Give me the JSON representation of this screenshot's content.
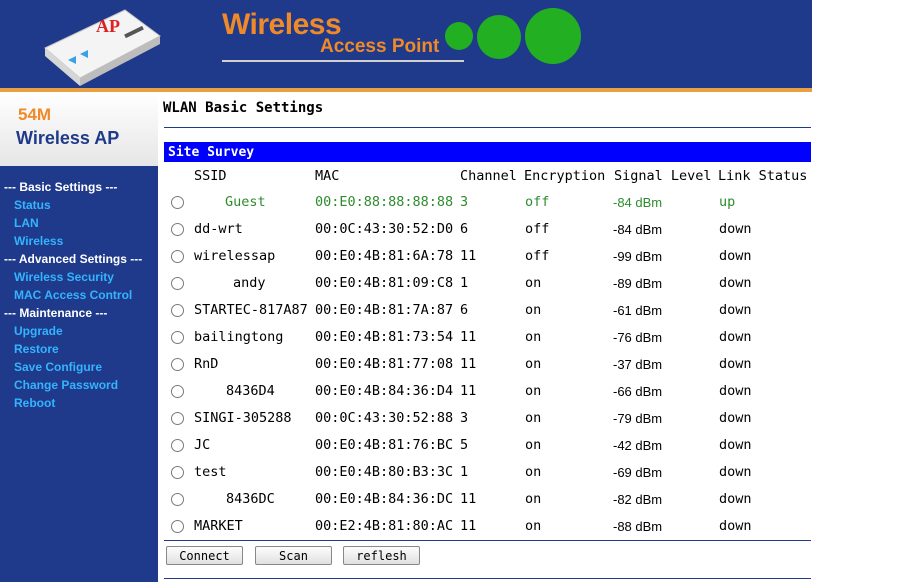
{
  "header": {
    "device_badge": "AP",
    "title_line1": "Wireless",
    "title_line2": "Access Point"
  },
  "logo": {
    "line1": "54M",
    "line2": "Wireless AP"
  },
  "sidebar": [
    {
      "label": "--- Basic Settings ---",
      "type": "heading"
    },
    {
      "label": "Status",
      "type": "link"
    },
    {
      "label": "LAN",
      "type": "link"
    },
    {
      "label": "Wireless",
      "type": "link"
    },
    {
      "label": "--- Advanced Settings ---",
      "type": "heading"
    },
    {
      "label": "Wireless Security",
      "type": "link"
    },
    {
      "label": "MAC Access Control",
      "type": "link"
    },
    {
      "label": "--- Maintenance ---",
      "type": "heading"
    },
    {
      "label": "Upgrade",
      "type": "link"
    },
    {
      "label": "Restore",
      "type": "link"
    },
    {
      "label": "Save Configure",
      "type": "link"
    },
    {
      "label": "Change Password",
      "type": "link"
    },
    {
      "label": "Reboot",
      "type": "link"
    }
  ],
  "page_title": "WLAN Basic Settings",
  "site_survey": {
    "label": "Site Survey",
    "columns": [
      "SSID",
      "MAC",
      "Channel",
      "Encryption",
      "Signal Level",
      "Link Status"
    ],
    "rows": [
      {
        "ssid": "Guest",
        "mac": "00:E0:88:88:88:88",
        "channel": "3",
        "encryption": "off",
        "signal": "-84 dBm",
        "link": "up"
      },
      {
        "ssid": "dd-wrt",
        "mac": "00:0C:43:30:52:D0",
        "channel": "6",
        "encryption": "off",
        "signal": "-84 dBm",
        "link": "down"
      },
      {
        "ssid": "wirelessap",
        "mac": "00:E0:4B:81:6A:78",
        "channel": "11",
        "encryption": "off",
        "signal": "-99 dBm",
        "link": "down"
      },
      {
        "ssid": "andy",
        "mac": "00:E0:4B:81:09:C8",
        "channel": "1",
        "encryption": "on",
        "signal": "-89 dBm",
        "link": "down"
      },
      {
        "ssid": "STARTEC-817A87",
        "mac": "00:E0:4B:81:7A:87",
        "channel": "6",
        "encryption": "on",
        "signal": "-61 dBm",
        "link": "down"
      },
      {
        "ssid": "bailingtong",
        "mac": "00:E0:4B:81:73:54",
        "channel": "11",
        "encryption": "on",
        "signal": "-76 dBm",
        "link": "down"
      },
      {
        "ssid": "RnD",
        "mac": "00:E0:4B:81:77:08",
        "channel": "11",
        "encryption": "on",
        "signal": "-37 dBm",
        "link": "down"
      },
      {
        "ssid": "8436D4",
        "mac": "00:E0:4B:84:36:D4",
        "channel": "11",
        "encryption": "on",
        "signal": "-66 dBm",
        "link": "down"
      },
      {
        "ssid": "SINGI-305288",
        "mac": "00:0C:43:30:52:88",
        "channel": "3",
        "encryption": "on",
        "signal": "-79 dBm",
        "link": "down"
      },
      {
        "ssid": "JC",
        "mac": "00:E0:4B:81:76:BC",
        "channel": "5",
        "encryption": "on",
        "signal": "-42 dBm",
        "link": "down"
      },
      {
        "ssid": "test",
        "mac": "00:E0:4B:80:B3:3C",
        "channel": "1",
        "encryption": "on",
        "signal": "-69 dBm",
        "link": "down"
      },
      {
        "ssid": "8436DC",
        "mac": "00:E0:4B:84:36:DC",
        "channel": "11",
        "encryption": "on",
        "signal": "-82 dBm",
        "link": "down"
      },
      {
        "ssid": "MARKET",
        "mac": "00:E2:4B:81:80:AC",
        "channel": "11",
        "encryption": "on",
        "signal": "-88 dBm",
        "link": "down"
      }
    ]
  },
  "buttons": {
    "connect": "Connect",
    "scan": "Scan",
    "refresh": "reflesh"
  }
}
